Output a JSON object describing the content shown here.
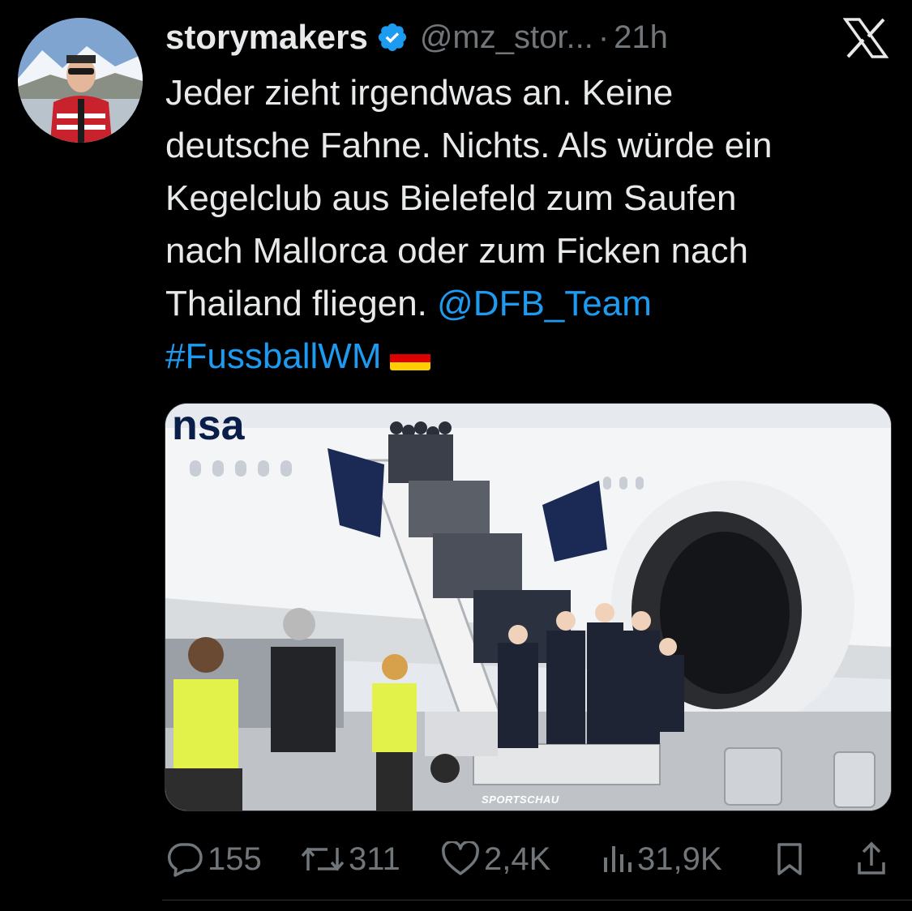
{
  "tweet": {
    "author_name": "storymakers",
    "handle": "@mz_stor...",
    "separator": "·",
    "time": "21h",
    "text_lines": [
      "Jeder zieht irgendwas an. Keine",
      "deutsche Fahne. Nichts. Als würde ein",
      "Kegelclub aus Bielefeld zum Saufen",
      "nach Mallorca oder zum Ficken nach"
    ],
    "last_line_prefix": "Thailand fliegen. ",
    "mention": "@DFB_Team",
    "hashtag": "#FussballWM",
    "flag_icon": "german-flag-emoji"
  },
  "media": {
    "plane_lettering": "nsa",
    "watermark": "SPORTSCHAU"
  },
  "actions": {
    "replies": "155",
    "retweets": "311",
    "likes": "2,4K",
    "views": "31,9K"
  },
  "colors": {
    "background": "#000000",
    "text": "#e7e9ea",
    "secondary": "#71767b",
    "link": "#1d9bf0",
    "verified": "#1d9bf0"
  }
}
